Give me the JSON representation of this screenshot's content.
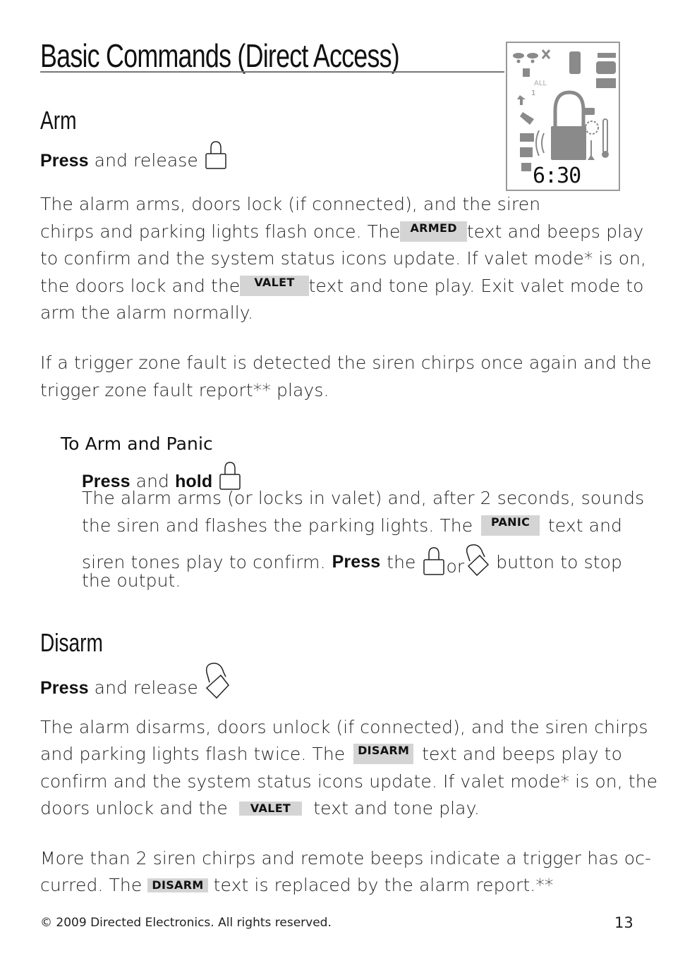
{
  "page": {
    "title": "Basic Commands (Direct Access)",
    "page_number": "13",
    "footer": "© 2009 Directed Electronics. All rights reserved."
  },
  "lcd": {
    "time": "6:30",
    "all_label": "ALL",
    "one_label": "1"
  },
  "arm": {
    "heading": "Arm",
    "press": "Press",
    "action": "and release",
    "para1_l1": "The alarm arms, doors lock (if connected), and the siren",
    "para1_l2a": "chirps and parking lights flash once. The",
    "badge_armed": "ARMED",
    "para1_l2b": "text and beeps play",
    "para1_l3": "to confirm and the system status icons update. If valet mode* is on,",
    "para1_l4a": "the doors lock and the",
    "badge_valet": "VALET",
    "para1_l4b": "text and tone play. Exit valet mode to",
    "para1_l5": "arm the alarm normally.",
    "para2_l1": "If a trigger zone fault is detected the siren chirps once again and the",
    "para2_l2": "trigger zone fault report** plays."
  },
  "panic": {
    "heading": "To Arm and Panic",
    "press": "Press",
    "and": "and",
    "hold": "hold",
    "l1": "The alarm arms (or locks in valet) and, after 2 seconds, sounds",
    "l2a": "the siren and flashes the parking lights. The",
    "badge_panic": "PANIC",
    "l2b": "text and",
    "l3a": "siren tones play to confirm.",
    "l3press": "Press",
    "l3b": "the",
    "l3or": "or",
    "l3c": "button to stop",
    "l4": "the output."
  },
  "disarm": {
    "heading": "Disarm",
    "press": "Press",
    "action": "and release",
    "p1_l1": "The alarm disarms, doors unlock (if connected), and the siren chirps",
    "p1_l2a": "and parking lights flash twice. The",
    "badge_disarm": "DISARM",
    "p1_l2b": "text and beeps play to",
    "p1_l3": "confirm and the system status icons update. If valet mode* is on, the",
    "p1_l4a": "doors unlock and the",
    "badge_valet": "VALET",
    "p1_l4b": "text and tone play.",
    "p2_l1": "More than 2 siren chirps and remote beeps indicate a trigger has oc-",
    "p2_l2a": "curred. The",
    "p2_l2b": "text is replaced by the alarm report.**"
  }
}
